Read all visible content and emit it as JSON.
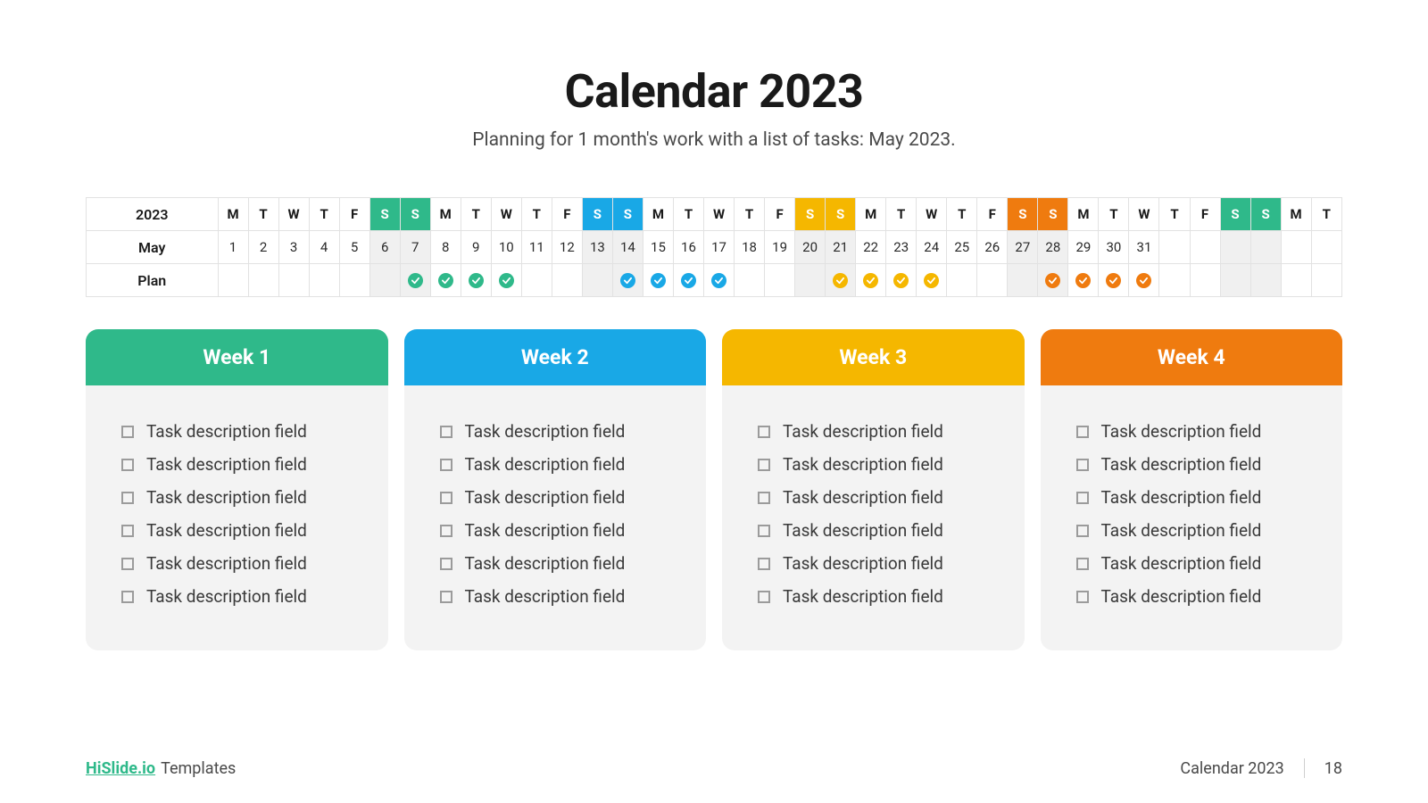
{
  "header": {
    "title": "Calendar 2023",
    "subtitle": "Planning for 1 month's work with a list of tasks: May 2023."
  },
  "calendar": {
    "row_labels": {
      "year": "2023",
      "month": "May",
      "plan": "Plan"
    },
    "days": [
      {
        "dow": "M",
        "date": "1",
        "weekendOf": null,
        "shadedDate": false,
        "plan": null
      },
      {
        "dow": "T",
        "date": "2",
        "weekendOf": null,
        "shadedDate": false,
        "plan": null
      },
      {
        "dow": "W",
        "date": "3",
        "weekendOf": null,
        "shadedDate": false,
        "plan": null
      },
      {
        "dow": "T",
        "date": "4",
        "weekendOf": null,
        "shadedDate": false,
        "plan": null
      },
      {
        "dow": "F",
        "date": "5",
        "weekendOf": null,
        "shadedDate": false,
        "plan": null
      },
      {
        "dow": "S",
        "date": "6",
        "weekendOf": "wk1",
        "shadedDate": true,
        "plan": null
      },
      {
        "dow": "S",
        "date": "7",
        "weekendOf": "wk1",
        "shadedDate": true,
        "plan": "wk1"
      },
      {
        "dow": "M",
        "date": "8",
        "weekendOf": null,
        "shadedDate": false,
        "plan": "wk1"
      },
      {
        "dow": "T",
        "date": "9",
        "weekendOf": null,
        "shadedDate": false,
        "plan": "wk1"
      },
      {
        "dow": "W",
        "date": "10",
        "weekendOf": null,
        "shadedDate": false,
        "plan": "wk1"
      },
      {
        "dow": "T",
        "date": "11",
        "weekendOf": null,
        "shadedDate": false,
        "plan": null
      },
      {
        "dow": "F",
        "date": "12",
        "weekendOf": null,
        "shadedDate": false,
        "plan": null
      },
      {
        "dow": "S",
        "date": "13",
        "weekendOf": "wk2",
        "shadedDate": true,
        "plan": null
      },
      {
        "dow": "S",
        "date": "14",
        "weekendOf": "wk2",
        "shadedDate": true,
        "plan": "wk2"
      },
      {
        "dow": "M",
        "date": "15",
        "weekendOf": null,
        "shadedDate": false,
        "plan": "wk2"
      },
      {
        "dow": "T",
        "date": "16",
        "weekendOf": null,
        "shadedDate": false,
        "plan": "wk2"
      },
      {
        "dow": "W",
        "date": "17",
        "weekendOf": null,
        "shadedDate": false,
        "plan": "wk2"
      },
      {
        "dow": "T",
        "date": "18",
        "weekendOf": null,
        "shadedDate": false,
        "plan": null
      },
      {
        "dow": "F",
        "date": "19",
        "weekendOf": null,
        "shadedDate": false,
        "plan": null
      },
      {
        "dow": "S",
        "date": "20",
        "weekendOf": "wk3",
        "shadedDate": true,
        "plan": null
      },
      {
        "dow": "S",
        "date": "21",
        "weekendOf": "wk3",
        "shadedDate": true,
        "plan": "wk3"
      },
      {
        "dow": "M",
        "date": "22",
        "weekendOf": null,
        "shadedDate": false,
        "plan": "wk3"
      },
      {
        "dow": "T",
        "date": "23",
        "weekendOf": null,
        "shadedDate": false,
        "plan": "wk3"
      },
      {
        "dow": "W",
        "date": "24",
        "weekendOf": null,
        "shadedDate": false,
        "plan": "wk3"
      },
      {
        "dow": "T",
        "date": "25",
        "weekendOf": null,
        "shadedDate": false,
        "plan": null
      },
      {
        "dow": "F",
        "date": "26",
        "weekendOf": null,
        "shadedDate": false,
        "plan": null
      },
      {
        "dow": "S",
        "date": "27",
        "weekendOf": "wk4",
        "shadedDate": true,
        "plan": null
      },
      {
        "dow": "S",
        "date": "28",
        "weekendOf": "wk4",
        "shadedDate": true,
        "plan": "wk4"
      },
      {
        "dow": "M",
        "date": "29",
        "weekendOf": null,
        "shadedDate": false,
        "plan": "wk4"
      },
      {
        "dow": "T",
        "date": "30",
        "weekendOf": null,
        "shadedDate": false,
        "plan": "wk4"
      },
      {
        "dow": "W",
        "date": "31",
        "weekendOf": null,
        "shadedDate": false,
        "plan": "wk4"
      },
      {
        "dow": "T",
        "date": "",
        "weekendOf": null,
        "shadedDate": false,
        "plan": null
      },
      {
        "dow": "F",
        "date": "",
        "weekendOf": null,
        "shadedDate": false,
        "plan": null
      },
      {
        "dow": "S",
        "date": "",
        "weekendOf": "wk1",
        "shadedDate": true,
        "plan": null
      },
      {
        "dow": "S",
        "date": "",
        "weekendOf": "wk1",
        "shadedDate": true,
        "plan": null
      },
      {
        "dow": "M",
        "date": "",
        "weekendOf": null,
        "shadedDate": false,
        "plan": null
      },
      {
        "dow": "T",
        "date": "",
        "weekendOf": null,
        "shadedDate": false,
        "plan": null
      }
    ]
  },
  "weeks": [
    {
      "label": "Week 1",
      "color": "wk1",
      "tasks": [
        "Task description field",
        "Task description field",
        "Task description field",
        "Task description field",
        "Task description field",
        "Task description field"
      ]
    },
    {
      "label": "Week 2",
      "color": "wk2",
      "tasks": [
        "Task description field",
        "Task description field",
        "Task description field",
        "Task description field",
        "Task description field",
        "Task description field"
      ]
    },
    {
      "label": "Week 3",
      "color": "wk3",
      "tasks": [
        "Task description field",
        "Task description field",
        "Task description field",
        "Task description field",
        "Task description field",
        "Task description field"
      ]
    },
    {
      "label": "Week 4",
      "color": "wk4",
      "tasks": [
        "Task description field",
        "Task description field",
        "Task description field",
        "Task description field",
        "Task description field",
        "Task description field"
      ]
    }
  ],
  "footer": {
    "brand": "HiSlide.io",
    "brand_suffix": "Templates",
    "right_text": "Calendar 2023",
    "page_number": "18"
  },
  "colors": {
    "wk1": "#2fb98a",
    "wk2": "#19a8e6",
    "wk3": "#f5b700",
    "wk4": "#ef7b0f"
  }
}
